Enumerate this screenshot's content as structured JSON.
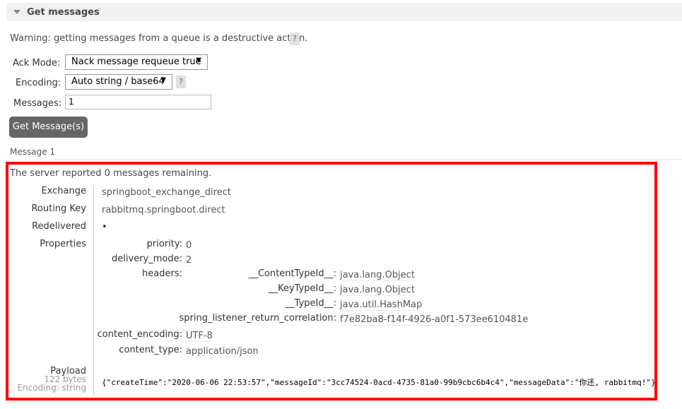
{
  "section": {
    "title": "Get messages"
  },
  "warning": {
    "text": "Warning: getting messages from a queue is a destructive action.",
    "help": "?"
  },
  "form": {
    "ack_mode_label": "Ack Mode:",
    "ack_mode_value": "Nack message requeue true",
    "encoding_label": "Encoding:",
    "encoding_value": "Auto string / base64",
    "encoding_help": "?",
    "messages_label": "Messages:",
    "messages_value": "1",
    "submit_label": "Get Message(s)"
  },
  "result": {
    "message_label": "Message 1",
    "remaining_text": "The server reported 0 messages remaining.",
    "exchange_label": "Exchange",
    "exchange_value": "springboot_exchange_direct",
    "routing_key_label": "Routing Key",
    "routing_key_value": "rabbitmq.springboot.direct",
    "redelivered_label": "Redelivered",
    "redelivered_value": "•",
    "properties_label": "Properties",
    "properties": {
      "priority_label": "priority:",
      "priority_value": "0",
      "delivery_mode_label": "delivery_mode:",
      "delivery_mode_value": "2",
      "headers_label": "headers:",
      "headers": [
        {
          "key": "__ContentTypeId__:",
          "value": "java.lang.Object"
        },
        {
          "key": "__KeyTypeId__:",
          "value": "java.lang.Object"
        },
        {
          "key": "__TypeId__:",
          "value": "java.util.HashMap"
        },
        {
          "key": "spring_listener_return_correlation:",
          "value": "f7e82ba8-f14f-4926-a0f1-573ee610481e"
        }
      ],
      "content_encoding_label": "content_encoding:",
      "content_encoding_value": "UTF-8",
      "content_type_label": "content_type:",
      "content_type_value": "application/json"
    },
    "payload_label": "Payload",
    "payload_size": "122 bytes",
    "payload_encoding": "Encoding: string",
    "payload_value": "{\"createTime\":\"2020-06-06 22:53:57\",\"messageId\":\"3cc74524-0acd-4735-81a0-99b9cbc6b4c4\",\"messageData\":\"你还, rabbitmq!\"}"
  }
}
